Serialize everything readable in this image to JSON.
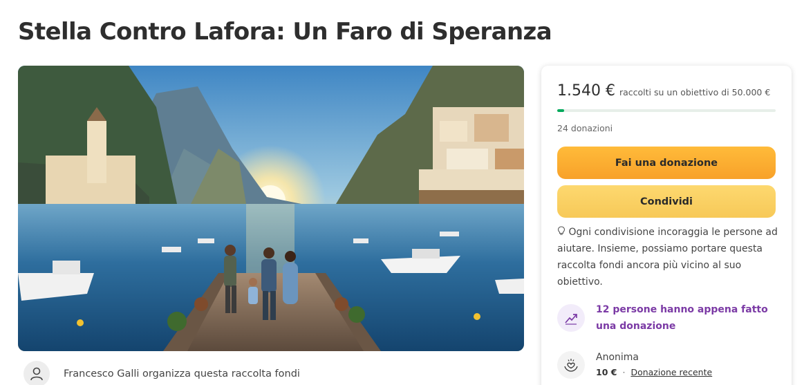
{
  "campaign": {
    "title": "Stella Contro Lafora: Un Faro di Speranza"
  },
  "organizer": {
    "text": "Francesco Galli organizza questa raccolta fondi",
    "avatar_icon": "user-icon"
  },
  "donation_card": {
    "raised": "1.540 €",
    "goal_text": "raccolti su un obiettivo di 50.000 €",
    "progress_fraction": 0.0308,
    "donations_count": "24 donazioni",
    "donate_label": "Fai una donazione",
    "share_label": "Condividi",
    "share_note": "Ogni condivisione incoraggia le persone ad aiutare. Insieme, possiamo portare questa raccolta fondi ancora più vicino al suo obiettivo.",
    "share_note_icon": "lightbulb-icon",
    "activity_text": "12 persone hanno appena fatto una donazione",
    "activity_icon": "trending-up-icon",
    "recent_donation": {
      "name": "Anonima",
      "amount": "10 €",
      "separator": "·",
      "link_label": "Donazione recente",
      "icon": "heart-hands-icon"
    }
  },
  "colors": {
    "progress": "#02a95c",
    "donate_button": "#f8a129",
    "share_button": "#f7c958",
    "activity_text": "#7b3aa5"
  }
}
